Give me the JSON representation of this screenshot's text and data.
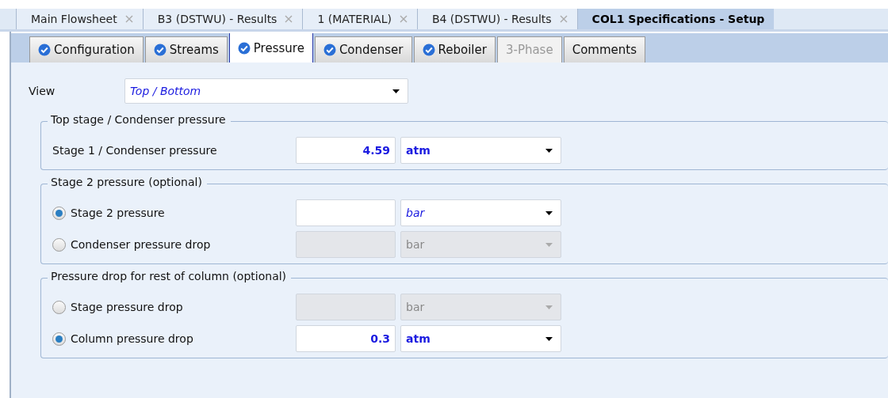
{
  "document_tabs": [
    {
      "label": "Main Flowsheet",
      "selected": false,
      "closable": true
    },
    {
      "label": "B3 (DSTWU) - Results",
      "selected": false,
      "closable": true
    },
    {
      "label": "1 (MATERIAL)",
      "selected": false,
      "closable": true
    },
    {
      "label": "B4 (DSTWU) - Results",
      "selected": false,
      "closable": true
    },
    {
      "label": "COL1 Specifications - Setup",
      "selected": true,
      "closable": false
    }
  ],
  "form_tabs": [
    {
      "label": "Configuration",
      "selected": false,
      "checked": true,
      "disabled": false
    },
    {
      "label": "Streams",
      "selected": false,
      "checked": true,
      "disabled": false
    },
    {
      "label": "Pressure",
      "selected": true,
      "checked": true,
      "disabled": false
    },
    {
      "label": "Condenser",
      "selected": false,
      "checked": true,
      "disabled": false
    },
    {
      "label": "Reboiler",
      "selected": false,
      "checked": true,
      "disabled": false
    },
    {
      "label": "3-Phase",
      "selected": false,
      "checked": false,
      "disabled": true
    },
    {
      "label": "Comments",
      "selected": false,
      "checked": false,
      "disabled": false
    }
  ],
  "view": {
    "label": "View",
    "value": "Top / Bottom"
  },
  "groups": [
    {
      "title": "Top stage / Condenser pressure",
      "rows": [
        {
          "kind": "plain",
          "label": "Stage 1 / Condenser pressure",
          "value": "4.59",
          "unit": "atm",
          "unit_entered": true,
          "disabled": false
        }
      ]
    },
    {
      "title": "Stage 2 pressure (optional)",
      "rows": [
        {
          "kind": "radio",
          "label": "Stage 2 pressure",
          "selected": true,
          "unit": "bar",
          "unit_entered": false,
          "disabled": false
        },
        {
          "kind": "radio",
          "label": "Condenser pressure drop",
          "selected": false,
          "unit": "bar",
          "disabled": true
        }
      ]
    },
    {
      "title": "Pressure drop for rest of column (optional)",
      "rows": [
        {
          "kind": "radio",
          "label": "Stage pressure drop",
          "selected": false,
          "unit": "bar",
          "disabled": true
        },
        {
          "kind": "radio",
          "label": "Column pressure drop",
          "selected": true,
          "value": "0.3",
          "unit": "atm",
          "unit_entered": true,
          "disabled": false
        }
      ]
    }
  ]
}
